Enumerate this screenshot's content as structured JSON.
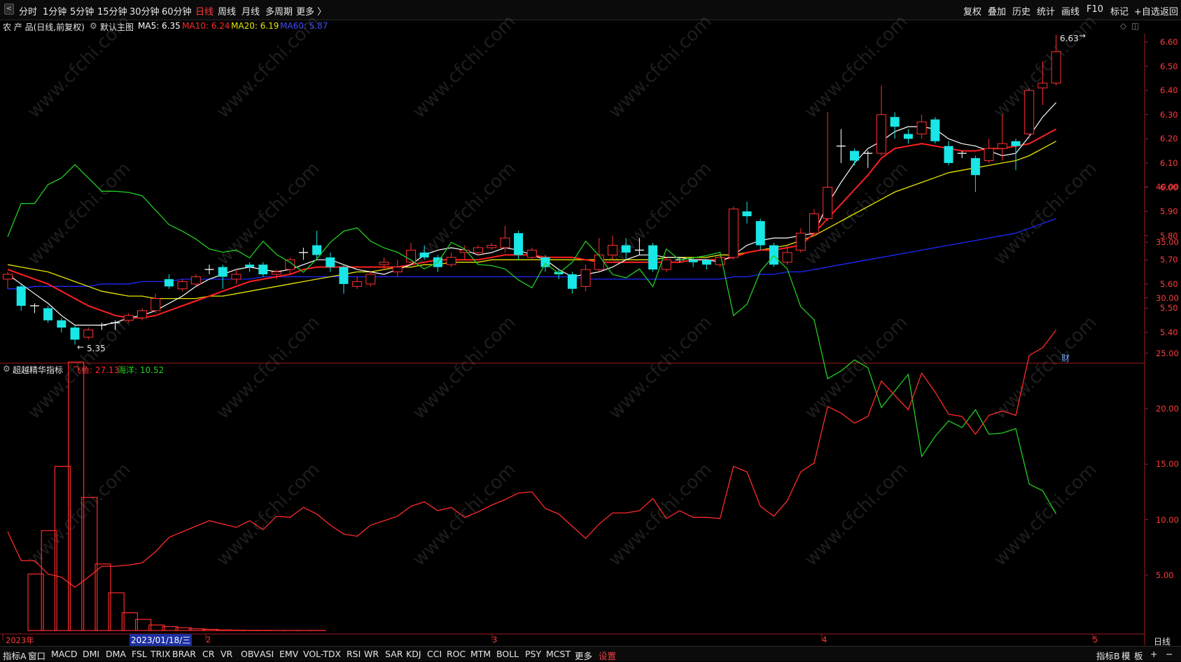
{
  "toolbar": {
    "periods": [
      "分时",
      "1分钟",
      "5分钟",
      "15分钟",
      "30分钟",
      "60分钟",
      "日线",
      "周线",
      "月线",
      "多周期",
      "更多 〉"
    ],
    "active_period": "日线",
    "right_buttons": [
      "复权",
      "叠加",
      "历史",
      "统计",
      "画线",
      "F10",
      "标记",
      "+自选",
      "返回"
    ]
  },
  "main_info": {
    "title": "农 产 品(日线,前复权)",
    "template": "默认主图",
    "ma5_label": "MA5: 6.35",
    "ma10_label": "MA10: 6.24",
    "ma20_label": "MA20: 6.19",
    "ma60_label": "MA60: 5.87"
  },
  "indicator_info": {
    "name": "超越精华指标",
    "fish_label": "飞鱼: 27.13",
    "ocean_label": "海洋: 10.52"
  },
  "annotations": {
    "high": "6.63",
    "low": "5.35",
    "finance_marker": "财"
  },
  "price_axis": [
    "6.60",
    "6.50",
    "6.40",
    "6.30",
    "6.20",
    "6.10",
    "6.00",
    "5.90",
    "5.80",
    "5.70",
    "5.60",
    "5.50",
    "5.40"
  ],
  "indicator_axis": [
    "40.00",
    "35.00",
    "30.00",
    "25.00",
    "20.00",
    "15.00",
    "10.00",
    "5.00"
  ],
  "date_axis": {
    "labels": [
      "2023年",
      "2",
      "3",
      "4",
      "5"
    ],
    "cursor_date": "2023/01/18/三",
    "period_box": "日线"
  },
  "bottom_tabs": [
    "指标A",
    "窗口",
    "MACD",
    "DMI",
    "DMA",
    "FSL",
    "TRIX",
    "BRAR",
    "CR",
    "VR",
    "OBV",
    "ASI",
    "EMV",
    "VOL-TDX",
    "RSI",
    "WR",
    "SAR",
    "KDJ",
    "CCI",
    "ROC",
    "MTM",
    "BOLL",
    "PSY",
    "MCST",
    "更多",
    "设置"
  ],
  "bottom_right": [
    "指标B",
    "模",
    "板",
    "+",
    "−"
  ],
  "watermark": "www.cfchi.com",
  "colors": {
    "up": "#ff3030",
    "down": "#19e6e6",
    "ma5": "#ffffff",
    "ma10": "#ff2020",
    "ma20": "#e6e600",
    "ma60": "#1e28ff",
    "fish": "#ff2a2a",
    "ocean": "#22cc22"
  },
  "chart_data": {
    "type": "candlestick",
    "title": "农 产 品(日线,前复权)",
    "ylim": [
      5.33,
      6.66
    ],
    "candles": [
      [
        5.62,
        5.64,
        5.65,
        5.58
      ],
      [
        5.59,
        5.51,
        5.6,
        5.49
      ],
      [
        5.51,
        5.51,
        5.52,
        5.48
      ],
      [
        5.5,
        5.45,
        5.51,
        5.44
      ],
      [
        5.45,
        5.42,
        5.46,
        5.4
      ],
      [
        5.42,
        5.37,
        5.43,
        5.35
      ],
      [
        5.38,
        5.41,
        5.42,
        5.37
      ],
      [
        5.43,
        5.43,
        5.44,
        5.41
      ],
      [
        5.44,
        5.44,
        5.45,
        5.41
      ],
      [
        5.45,
        5.47,
        5.48,
        5.44
      ],
      [
        5.46,
        5.49,
        5.5,
        5.45
      ],
      [
        5.49,
        5.54,
        5.56,
        5.48
      ],
      [
        5.62,
        5.59,
        5.64,
        5.58
      ],
      [
        5.58,
        5.61,
        5.62,
        5.57
      ],
      [
        5.6,
        5.63,
        5.64,
        5.59
      ],
      [
        5.66,
        5.66,
        5.68,
        5.64
      ],
      [
        5.67,
        5.63,
        5.68,
        5.58
      ],
      [
        5.62,
        5.64,
        5.66,
        5.6
      ],
      [
        5.68,
        5.67,
        5.69,
        5.65
      ],
      [
        5.68,
        5.64,
        5.69,
        5.63
      ],
      [
        5.64,
        5.65,
        5.66,
        5.62
      ],
      [
        5.66,
        5.7,
        5.71,
        5.64
      ],
      [
        5.73,
        5.73,
        5.75,
        5.7
      ],
      [
        5.76,
        5.72,
        5.82,
        5.7
      ],
      [
        5.71,
        5.67,
        5.73,
        5.65
      ],
      [
        5.67,
        5.6,
        5.68,
        5.56
      ],
      [
        5.59,
        5.61,
        5.63,
        5.58
      ],
      [
        5.6,
        5.64,
        5.65,
        5.59
      ],
      [
        5.68,
        5.69,
        5.71,
        5.66
      ],
      [
        5.65,
        5.67,
        5.7,
        5.63
      ],
      [
        5.69,
        5.74,
        5.77,
        5.68
      ],
      [
        5.73,
        5.71,
        5.76,
        5.7
      ],
      [
        5.71,
        5.67,
        5.72,
        5.65
      ],
      [
        5.68,
        5.71,
        5.73,
        5.67
      ],
      [
        5.73,
        5.74,
        5.76,
        5.7
      ],
      [
        5.73,
        5.75,
        5.76,
        5.72
      ],
      [
        5.75,
        5.76,
        5.77,
        5.74
      ],
      [
        5.75,
        5.79,
        5.84,
        5.73
      ],
      [
        5.81,
        5.72,
        5.82,
        5.7
      ],
      [
        5.71,
        5.74,
        5.75,
        5.7
      ],
      [
        5.71,
        5.67,
        5.72,
        5.65
      ],
      [
        5.65,
        5.64,
        5.66,
        5.62
      ],
      [
        5.64,
        5.58,
        5.65,
        5.56
      ],
      [
        5.59,
        5.66,
        5.68,
        5.57
      ],
      [
        5.66,
        5.72,
        5.79,
        5.65
      ],
      [
        5.72,
        5.76,
        5.8,
        5.7
      ],
      [
        5.76,
        5.73,
        5.79,
        5.7
      ],
      [
        5.74,
        5.74,
        5.79,
        5.72
      ],
      [
        5.76,
        5.66,
        5.77,
        5.65
      ],
      [
        5.66,
        5.7,
        5.71,
        5.65
      ],
      [
        5.7,
        5.7,
        5.71,
        5.69
      ],
      [
        5.7,
        5.69,
        5.71,
        5.67
      ],
      [
        5.7,
        5.68,
        5.7,
        5.66
      ],
      [
        5.68,
        5.71,
        5.72,
        5.67
      ],
      [
        5.71,
        5.91,
        5.92,
        5.7
      ],
      [
        5.9,
        5.88,
        5.94,
        5.85
      ],
      [
        5.86,
        5.76,
        5.87,
        5.74
      ],
      [
        5.76,
        5.68,
        5.77,
        5.67
      ],
      [
        5.69,
        5.73,
        5.76,
        5.68
      ],
      [
        5.74,
        5.81,
        5.83,
        5.73
      ],
      [
        5.81,
        5.89,
        5.91,
        5.8
      ],
      [
        5.87,
        6.0,
        6.31,
        5.86
      ],
      [
        6.17,
        6.17,
        6.24,
        6.1
      ],
      [
        6.15,
        6.11,
        6.16,
        6.09
      ],
      [
        6.14,
        6.14,
        6.15,
        6.08
      ],
      [
        6.14,
        6.3,
        6.42,
        6.13
      ],
      [
        6.29,
        6.25,
        6.31,
        6.2
      ],
      [
        6.22,
        6.2,
        6.24,
        6.18
      ],
      [
        6.22,
        6.27,
        6.3,
        6.2
      ],
      [
        6.28,
        6.19,
        6.29,
        6.18
      ],
      [
        6.17,
        6.1,
        6.19,
        6.09
      ],
      [
        6.14,
        6.14,
        6.15,
        6.12
      ],
      [
        6.12,
        6.05,
        6.13,
        5.98
      ],
      [
        6.11,
        6.16,
        6.2,
        6.1
      ],
      [
        6.16,
        6.18,
        6.3,
        6.11
      ],
      [
        6.19,
        6.17,
        6.2,
        6.07
      ],
      [
        6.22,
        6.4,
        6.41,
        6.2
      ],
      [
        6.41,
        6.43,
        6.52,
        6.34
      ],
      [
        6.43,
        6.56,
        6.63,
        6.42
      ]
    ],
    "ma5": [
      5.64,
      5.6,
      5.56,
      5.52,
      5.47,
      5.43,
      5.43,
      5.43,
      5.44,
      5.46,
      5.47,
      5.49,
      5.52,
      5.55,
      5.59,
      5.62,
      5.64,
      5.66,
      5.67,
      5.66,
      5.65,
      5.66,
      5.68,
      5.7,
      5.7,
      5.68,
      5.66,
      5.65,
      5.64,
      5.66,
      5.68,
      5.72,
      5.74,
      5.75,
      5.74,
      5.72,
      5.73,
      5.75,
      5.74,
      5.72,
      5.7,
      5.66,
      5.63,
      5.64,
      5.65,
      5.67,
      5.7,
      5.72,
      5.72,
      5.71,
      5.71,
      5.7,
      5.7,
      5.69,
      5.72,
      5.76,
      5.78,
      5.79,
      5.79,
      5.8,
      5.81,
      5.93,
      6.02,
      6.1,
      6.16,
      6.19,
      6.23,
      6.25,
      6.25,
      6.24,
      6.2,
      6.18,
      6.17,
      6.15,
      6.13,
      6.14,
      6.21,
      6.29,
      6.35
    ],
    "ma10": [
      5.66,
      5.64,
      5.62,
      5.6,
      5.57,
      5.54,
      5.51,
      5.49,
      5.47,
      5.46,
      5.46,
      5.47,
      5.49,
      5.51,
      5.53,
      5.55,
      5.57,
      5.59,
      5.61,
      5.62,
      5.63,
      5.64,
      5.66,
      5.67,
      5.67,
      5.67,
      5.67,
      5.67,
      5.67,
      5.67,
      5.68,
      5.69,
      5.7,
      5.7,
      5.7,
      5.7,
      5.71,
      5.72,
      5.72,
      5.72,
      5.71,
      5.71,
      5.71,
      5.7,
      5.69,
      5.69,
      5.69,
      5.69,
      5.69,
      5.69,
      5.69,
      5.7,
      5.7,
      5.7,
      5.71,
      5.73,
      5.74,
      5.74,
      5.75,
      5.76,
      5.81,
      5.87,
      5.93,
      5.99,
      6.05,
      6.12,
      6.16,
      6.17,
      6.18,
      6.17,
      6.16,
      6.15,
      6.15,
      6.16,
      6.16,
      6.17,
      6.18,
      6.21,
      6.24
    ],
    "ma20": [
      5.68,
      5.67,
      5.66,
      5.65,
      5.63,
      5.61,
      5.59,
      5.57,
      5.56,
      5.55,
      5.55,
      5.54,
      5.54,
      5.54,
      5.54,
      5.55,
      5.55,
      5.56,
      5.57,
      5.58,
      5.59,
      5.6,
      5.61,
      5.62,
      5.63,
      5.64,
      5.65,
      5.65,
      5.66,
      5.67,
      5.67,
      5.68,
      5.68,
      5.69,
      5.69,
      5.69,
      5.7,
      5.7,
      5.7,
      5.7,
      5.7,
      5.7,
      5.7,
      5.7,
      5.7,
      5.7,
      5.7,
      5.7,
      5.7,
      5.71,
      5.71,
      5.71,
      5.71,
      5.72,
      5.72,
      5.73,
      5.74,
      5.75,
      5.76,
      5.78,
      5.8,
      5.83,
      5.86,
      5.89,
      5.92,
      5.95,
      5.98,
      6.0,
      6.02,
      6.04,
      6.06,
      6.07,
      6.08,
      6.09,
      6.1,
      6.11,
      6.13,
      6.16,
      6.19
    ],
    "ma60": [
      5.58,
      5.58,
      5.59,
      5.59,
      5.59,
      5.59,
      5.59,
      5.6,
      5.6,
      5.6,
      5.61,
      5.61,
      5.61,
      5.62,
      5.62,
      5.62,
      5.62,
      5.62,
      5.62,
      5.63,
      5.63,
      5.63,
      5.63,
      5.63,
      5.63,
      5.63,
      5.63,
      5.63,
      5.63,
      5.63,
      5.63,
      5.63,
      5.63,
      5.63,
      5.63,
      5.63,
      5.63,
      5.63,
      5.63,
      5.63,
      5.63,
      5.63,
      5.63,
      5.62,
      5.62,
      5.62,
      5.62,
      5.62,
      5.62,
      5.62,
      5.62,
      5.62,
      5.62,
      5.62,
      5.63,
      5.63,
      5.64,
      5.64,
      5.65,
      5.65,
      5.66,
      5.67,
      5.68,
      5.69,
      5.7,
      5.71,
      5.72,
      5.73,
      5.74,
      5.75,
      5.76,
      5.77,
      5.78,
      5.79,
      5.8,
      5.81,
      5.83,
      5.85,
      5.87
    ],
    "indicator": {
      "name": "超越精华指标",
      "ylim": [
        0,
        44
      ],
      "ocean": [
        35.5,
        38.5,
        38.5,
        40.2,
        40.8,
        42,
        40.8,
        39.6,
        39.6,
        39.5,
        39.2,
        37.9,
        36.6,
        36,
        35.3,
        34.4,
        34.1,
        34.3,
        33.6,
        35.1,
        33.9,
        33.2,
        32.3,
        33.5,
        35,
        36,
        36.3,
        35.1,
        34.5,
        34.1,
        33.4,
        32.6,
        33.2,
        35,
        34.4,
        33,
        32.9,
        32.6,
        31.6,
        30.9,
        33.1,
        32.2,
        33.2,
        35.1,
        33.8,
        32.1,
        31.8,
        32.6,
        31,
        34.4,
        33.4,
        33.6,
        33.8,
        34.1,
        28.4,
        29.4,
        32.4,
        33.8,
        32.6,
        29.2,
        28,
        22.7,
        23.4,
        24.4,
        23.7,
        20.1,
        21.6,
        23.1,
        15.7,
        17.5,
        18.9,
        18.3,
        19.9,
        17.7,
        17.8,
        18.2,
        13.2,
        12.6,
        10.5
      ],
      "fish": [
        8.9,
        6.3,
        6.3,
        5.1,
        4.8,
        3.9,
        4.8,
        5.8,
        5.8,
        5.9,
        6.1,
        7.1,
        8.4,
        8.9,
        9.4,
        9.9,
        9.6,
        9.3,
        9.9,
        9.1,
        10.3,
        10.2,
        11.1,
        10.5,
        9.5,
        8.7,
        8.5,
        9.5,
        9.9,
        10.3,
        11.2,
        11.6,
        10.8,
        11.1,
        10.2,
        10.7,
        11.3,
        11.8,
        12.4,
        12.5,
        11,
        10.5,
        9.4,
        8.3,
        9.6,
        10.6,
        10.6,
        10.8,
        11.9,
        10.1,
        10.8,
        10.2,
        10.2,
        10.1,
        14.8,
        14.3,
        11.2,
        10.3,
        11.7,
        14.3,
        15.1,
        20.2,
        19.6,
        18.7,
        19.3,
        22.5,
        21.2,
        19.9,
        23.2,
        21.5,
        19.5,
        19.3,
        17.7,
        19.4,
        19.8,
        19.4,
        24.8,
        25.5,
        27.1
      ],
      "bars": [
        5.1,
        9,
        14.8,
        24.2,
        12,
        6,
        3.4,
        1.6,
        1,
        0.5,
        0.35,
        0.25,
        0.15,
        0.1,
        0.05,
        0.03,
        0.02,
        0.02,
        0.01,
        0.01,
        0.01,
        0.01
      ]
    }
  }
}
